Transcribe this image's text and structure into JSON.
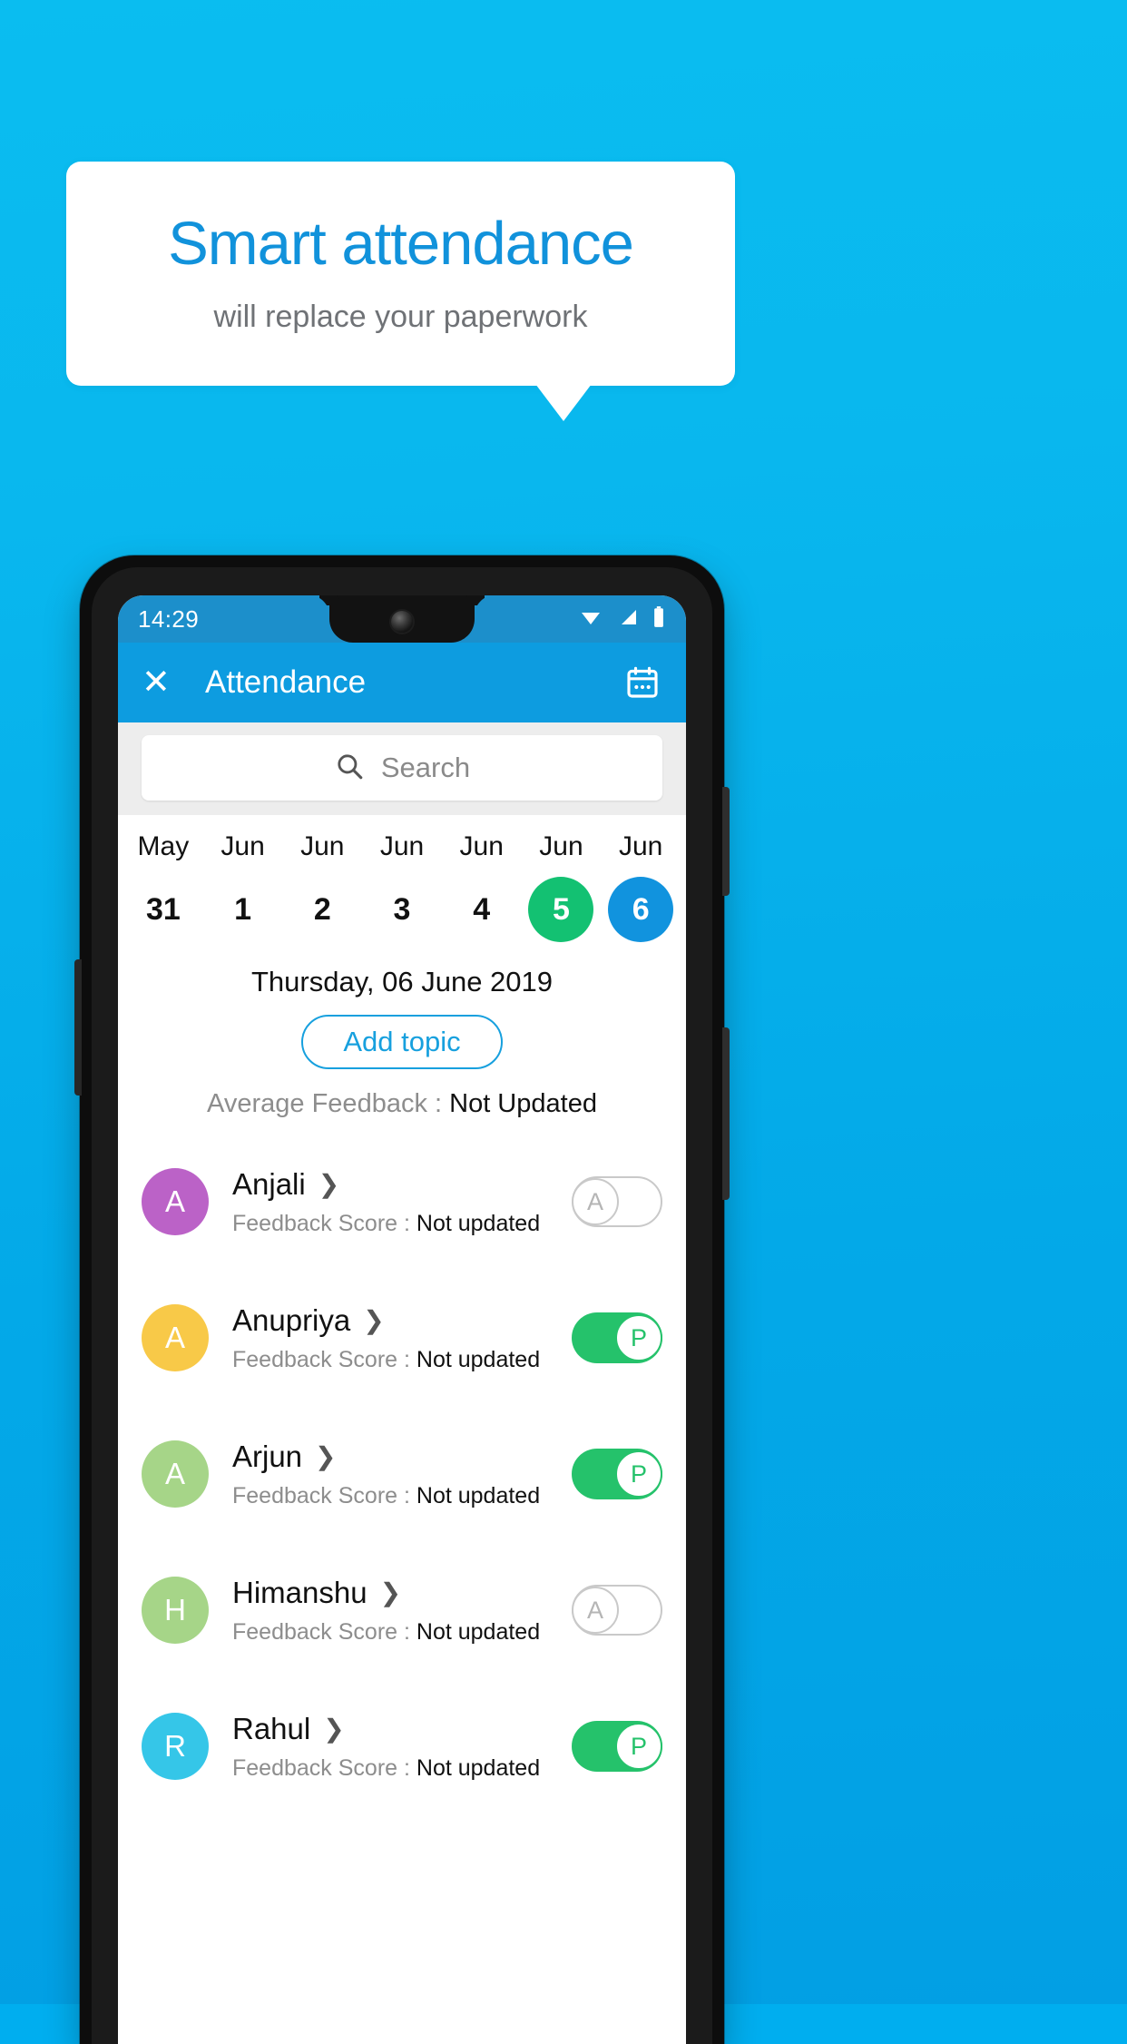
{
  "promo": {
    "title": "Smart attendance",
    "subtitle": "will replace your paperwork",
    "title_color": "#1192DB",
    "subtitle_color": "#6F7276"
  },
  "background_color": "#00AEEF",
  "phone": {
    "statusbar": {
      "time": "14:29",
      "icons": [
        "wifi-icon",
        "signal-icon",
        "battery-icon"
      ]
    },
    "appbar": {
      "close_label": "✕",
      "title": "Attendance",
      "calendar_icon": "calendar-icon",
      "background_color": "#0D9CE0"
    },
    "search": {
      "placeholder": "Search",
      "icon": "search-icon"
    },
    "date_strip": [
      {
        "month": "May",
        "day": "31",
        "state": "normal"
      },
      {
        "month": "Jun",
        "day": "1",
        "state": "normal"
      },
      {
        "month": "Jun",
        "day": "2",
        "state": "normal"
      },
      {
        "month": "Jun",
        "day": "3",
        "state": "normal"
      },
      {
        "month": "Jun",
        "day": "4",
        "state": "normal"
      },
      {
        "month": "Jun",
        "day": "5",
        "state": "green"
      },
      {
        "month": "Jun",
        "day": "6",
        "state": "blue"
      }
    ],
    "selected_day_label": "Thursday, 06 June 2019",
    "add_topic_label": "Add topic",
    "average_feedback": {
      "label": "Average Feedback : ",
      "value": "Not Updated"
    },
    "feedback_label": "Feedback Score : ",
    "students": [
      {
        "name": "Anjali",
        "initial": "A",
        "avatar_color": "#BB62C7",
        "feedback_value": "Not updated",
        "attendance": "A",
        "toggle_state": "off"
      },
      {
        "name": "Anupriya",
        "initial": "A",
        "avatar_color": "#F8C948",
        "feedback_value": "Not updated",
        "attendance": "P",
        "toggle_state": "on"
      },
      {
        "name": "Arjun",
        "initial": "A",
        "avatar_color": "#A6D588",
        "feedback_value": "Not updated",
        "attendance": "P",
        "toggle_state": "on"
      },
      {
        "name": "Himanshu",
        "initial": "H",
        "avatar_color": "#A6D588",
        "feedback_value": "Not updated",
        "attendance": "A",
        "toggle_state": "off"
      },
      {
        "name": "Rahul",
        "initial": "R",
        "avatar_color": "#35C6E8",
        "feedback_value": "Not updated",
        "attendance": "P",
        "toggle_state": "on"
      }
    ]
  }
}
